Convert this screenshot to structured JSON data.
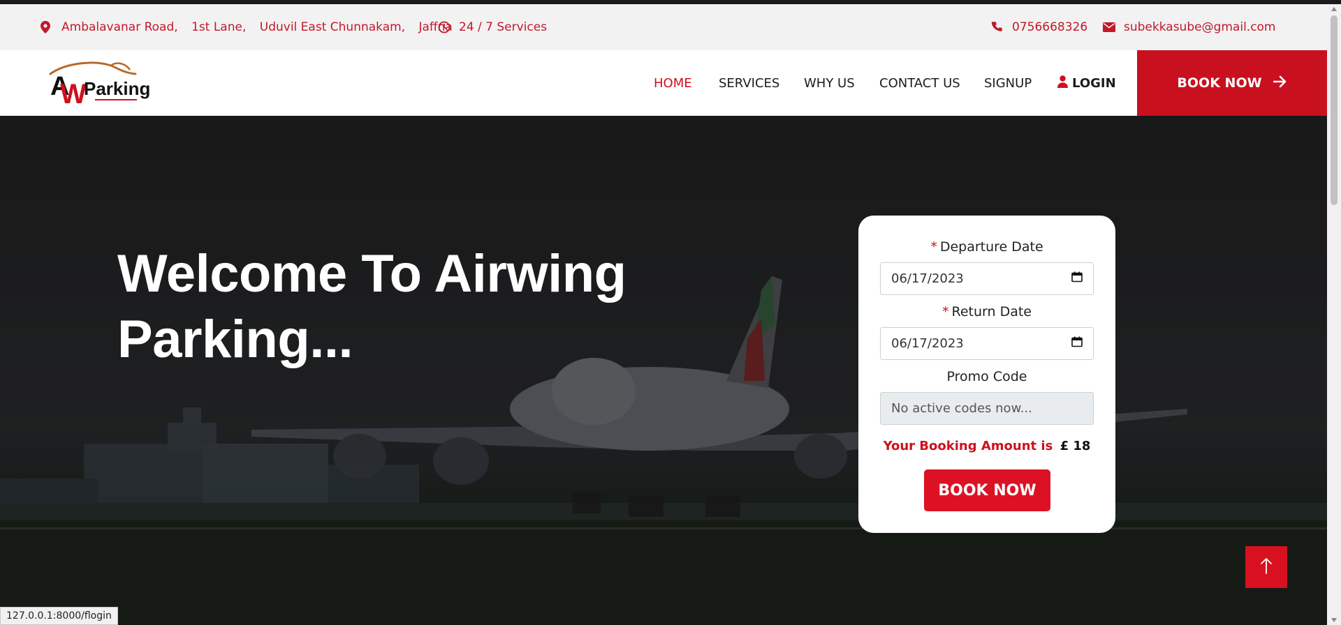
{
  "topbar": {
    "address_parts": [
      "Ambalavanar Road,",
      "1st Lane,",
      "Uduvil East Chunnakam,",
      "Jaffna"
    ],
    "hours": "24 / 7 Services",
    "phone": "0756668326",
    "email": "subekkasube@gmail.com"
  },
  "brand": {
    "logo_initials": "A",
    "logo_text": "Parking",
    "logo_letter": "W"
  },
  "nav": {
    "home": "HOME",
    "services": "SERVICES",
    "why_us": "WHY US",
    "contact": "CONTACT US",
    "signup": "SIGNUP",
    "login": "LOGIN",
    "book_now": "BOOK NOW"
  },
  "hero": {
    "title_line1": "Welcome To Airwing",
    "title_line2": "Parking..."
  },
  "booking": {
    "required_marker": "*",
    "departure_label": "Departure Date",
    "departure_value": "06/17/2023",
    "return_label": "Return Date",
    "return_value": "06/17/2023",
    "promo_label": "Promo Code",
    "promo_placeholder": "No active codes now...",
    "amount_label": "Your Booking Amount is",
    "amount_value": "£ 18",
    "submit_label": "BOOK NOW"
  },
  "status_url": "127.0.0.1:8000/flogin",
  "colors": {
    "accent": "#d0101d",
    "topbar_bg": "#f2f2f2"
  },
  "icons": [
    "map-marker-icon",
    "clock-icon",
    "phone-icon",
    "envelope-icon",
    "user-icon",
    "arrow-right-icon",
    "arrow-up-icon",
    "calendar-icon"
  ]
}
